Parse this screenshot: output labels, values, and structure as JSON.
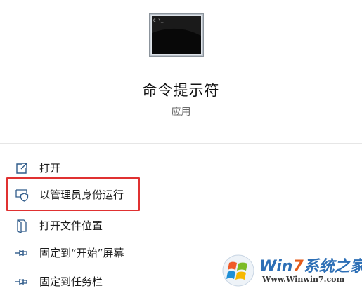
{
  "app": {
    "title": "命令提示符",
    "subtitle": "应用",
    "icon": "cmd-window-icon"
  },
  "menu": {
    "items": [
      {
        "label": "打开",
        "icon": "open-external-icon"
      },
      {
        "label": "以管理员身份运行",
        "icon": "admin-shield-icon",
        "highlighted": true
      },
      {
        "label": "打开文件位置",
        "icon": "file-location-icon"
      },
      {
        "label": "固定到“开始”屏幕",
        "icon": "pin-icon"
      },
      {
        "label": "固定到任务栏",
        "icon": "pin-icon"
      }
    ]
  },
  "colors": {
    "highlight": "#e03131",
    "icon_blue": "#2f5b8a",
    "watermark_blue": "#2d6fb6",
    "watermark_orange": "#e45b1a"
  },
  "watermark": {
    "brand_prefix": "Win",
    "brand_seven": "7",
    "brand_suffix": "系统之家",
    "url": "Www.Winwin7.com"
  }
}
